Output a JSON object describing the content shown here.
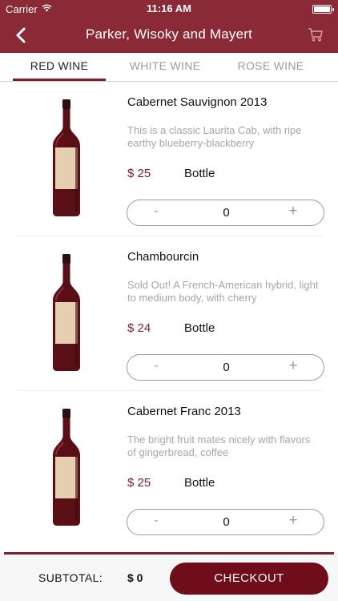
{
  "status_bar": {
    "carrier": "Carrier",
    "time": "11:16 AM"
  },
  "nav": {
    "title": "Parker, Wisoky and Mayert"
  },
  "tabs": [
    {
      "label": "RED WINE",
      "active": true
    },
    {
      "label": "WHITE WINE",
      "active": false
    },
    {
      "label": "ROSE WINE",
      "active": false
    }
  ],
  "products": [
    {
      "name": "Cabernet Sauvignon 2013",
      "description": "This is a classic Laurita Cab, with ripe earthy blueberry-blackberry",
      "price": "$ 25",
      "unit": "Bottle",
      "quantity": "0",
      "minus": "-",
      "plus": "+"
    },
    {
      "name": "Chambourcin",
      "description": "Sold Out! A French-American hybrid, light to medium body, with cherry",
      "price": "$ 24",
      "unit": "Bottle",
      "quantity": "0",
      "minus": "-",
      "plus": "+"
    },
    {
      "name": "Cabernet Franc 2013",
      "description": "The bright fruit mates nicely with flavors of gingerbread, coffee",
      "price": "$ 25",
      "unit": "Bottle",
      "quantity": "0",
      "minus": "-",
      "plus": "+"
    }
  ],
  "footer": {
    "subtotal_label": "SUBTOTAL:",
    "subtotal_value": "$ 0",
    "checkout_label": "CHECKOUT"
  },
  "colors": {
    "header": "#8a2a36",
    "accent": "#7a1f2b",
    "checkout": "#6f0d1b",
    "muted_text": "#a6a6a6"
  },
  "icons": {
    "back": "chevron-left-icon",
    "cart": "cart-icon",
    "wifi": "wifi-icon",
    "battery": "battery-icon",
    "bottle": "wine-bottle-image"
  }
}
